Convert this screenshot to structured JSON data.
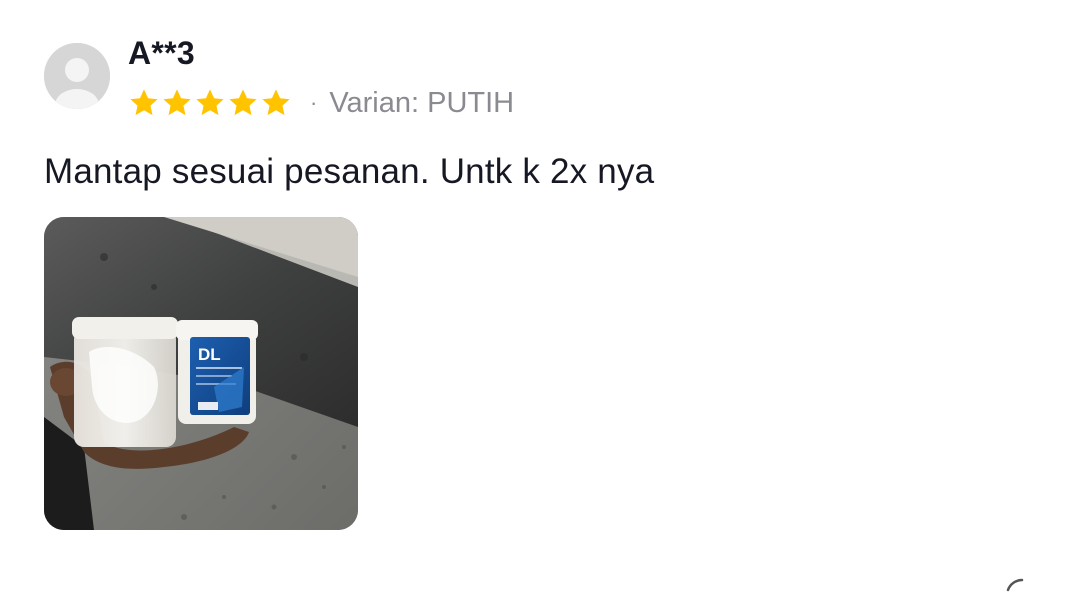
{
  "review": {
    "username": "A**3",
    "rating": 5,
    "rating_max": 5,
    "separator": "·",
    "variant_text": "Varian: PUTIH",
    "body_text": "Mantap sesuai pesanan. Untk k 2x nya",
    "photo_label": "DL",
    "colors": {
      "star": "#FFC300",
      "username": "#161823",
      "meta": "#8A8B91",
      "avatar_bg": "#D6D6D6"
    }
  },
  "icons": {
    "avatar": "default-user-avatar-icon",
    "star": "star-filled-icon",
    "corner": "more-icon"
  }
}
